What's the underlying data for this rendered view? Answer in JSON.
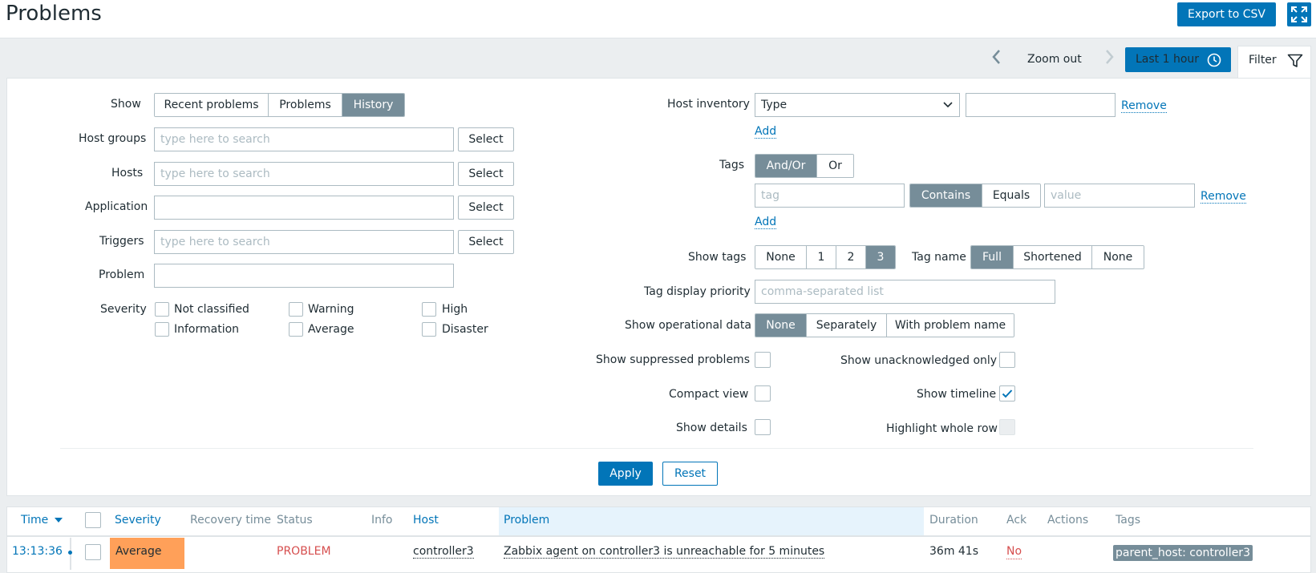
{
  "header": {
    "title": "Problems",
    "export_label": "Export to CSV"
  },
  "timebar": {
    "zoom_out": "Zoom out",
    "period": "Last 1 hour",
    "filter_tab": "Filter"
  },
  "filter": {
    "show_label": "Show",
    "show_options": [
      "Recent problems",
      "Problems",
      "History"
    ],
    "show_selected": "History",
    "host_groups_label": "Host groups",
    "hosts_label": "Hosts",
    "application_label": "Application",
    "triggers_label": "Triggers",
    "problem_label": "Problem",
    "search_placeholder": "type here to search",
    "select_label": "Select",
    "severity_label": "Severity",
    "severities": [
      "Not classified",
      "Information",
      "Warning",
      "Average",
      "High",
      "Disaster"
    ],
    "host_inventory_label": "Host inventory",
    "inventory_field": "Type",
    "remove_label": "Remove",
    "add_label": "Add",
    "tags_label": "Tags",
    "tags_operator_options": [
      "And/Or",
      "Or"
    ],
    "tags_operator_selected": "And/Or",
    "tag_placeholder": "tag",
    "tag_match_options": [
      "Contains",
      "Equals"
    ],
    "tag_match_selected": "Contains",
    "value_placeholder": "value",
    "show_tags_label": "Show tags",
    "show_tags_options": [
      "None",
      "1",
      "2",
      "3"
    ],
    "show_tags_selected": "3",
    "tag_name_label": "Tag name",
    "tag_name_options": [
      "Full",
      "Shortened",
      "None"
    ],
    "tag_name_selected": "Full",
    "tag_priority_label": "Tag display priority",
    "tag_priority_placeholder": "comma-separated list",
    "opdata_label": "Show operational data",
    "opdata_options": [
      "None",
      "Separately",
      "With problem name"
    ],
    "opdata_selected": "None",
    "suppressed_label": "Show suppressed problems",
    "unack_label": "Show unacknowledged only",
    "compact_label": "Compact view",
    "timeline_label": "Show timeline",
    "timeline_checked": true,
    "details_label": "Show details",
    "highlight_label": "Highlight whole row",
    "apply_label": "Apply",
    "reset_label": "Reset"
  },
  "table": {
    "columns": [
      "Time",
      "Severity",
      "Recovery time",
      "Status",
      "Info",
      "Host",
      "Problem",
      "Duration",
      "Ack",
      "Actions",
      "Tags"
    ],
    "rows": [
      {
        "time": "13:13:36",
        "severity": "Average",
        "recovery_time": "",
        "status": "PROBLEM",
        "info": "",
        "host": "controller3",
        "problem": "Zabbix agent on controller3 is unreachable for 5 minutes",
        "duration": "36m 41s",
        "ack": "No",
        "actions": "",
        "tags": [
          "parent_host: controller3"
        ]
      }
    ]
  },
  "colors": {
    "accent": "#0275b8",
    "severity_average": "#ffa059",
    "status_problem": "#d64e4e",
    "segment_selected": "#768d99"
  }
}
